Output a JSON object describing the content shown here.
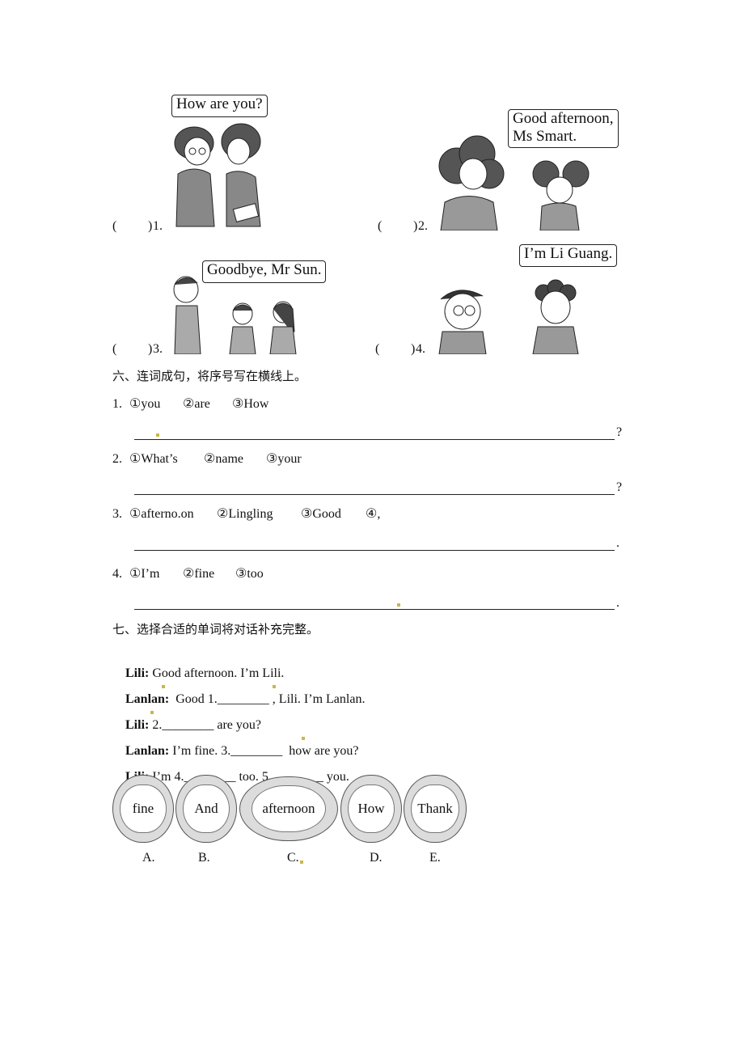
{
  "picture_matching": {
    "items": [
      {
        "number": "1.",
        "bracket_open": "(",
        "bracket_close": ")",
        "bubble": "How are you?"
      },
      {
        "number": "2.",
        "bracket_open": "(",
        "bracket_close": ")",
        "bubble": "Good afternoon,\nMs Smart."
      },
      {
        "number": "3.",
        "bracket_open": "(",
        "bracket_close": ")",
        "bubble": "Goodbye, Mr Sun."
      },
      {
        "number": "4.",
        "bracket_open": "(",
        "bracket_close": ")",
        "bubble": "I’m Li Guang."
      }
    ]
  },
  "section6": {
    "title": "六、连词成句，将序号写在横线上。",
    "questions": [
      {
        "label": "1.",
        "words": [
          "①you",
          "②are",
          "③How"
        ],
        "end_punct": "?"
      },
      {
        "label": "2.",
        "words": [
          "①What’s",
          "②name",
          "③your"
        ],
        "end_punct": "?"
      },
      {
        "label": "3.",
        "words": [
          "①afterno.on",
          "②Lingling",
          "③Good",
          "④,"
        ],
        "end_punct": "."
      },
      {
        "label": "4.",
        "words": [
          "①I’m",
          "②fine",
          "③too"
        ],
        "end_punct": "."
      }
    ]
  },
  "section7": {
    "title": "七、选择合适的单词将对话补充完整。",
    "dialogue": [
      {
        "speaker": "Lili:",
        "text": " Good afternoon. I’m Lili."
      },
      {
        "speaker": "Lanlan:",
        "text": "  Good 1.________ , Lili. I’m Lanlan."
      },
      {
        "speaker": "Lili:",
        "text": " 2.________ are you?"
      },
      {
        "speaker": "Lanlan:",
        "text": " I’m fine. 3.________  how are you?"
      },
      {
        "speaker": "Lili:",
        "text": " I’m 4.________ too. 5.________ you."
      }
    ],
    "options": [
      {
        "letter": "A.",
        "word": "fine"
      },
      {
        "letter": "B.",
        "word": "And"
      },
      {
        "letter": "C.",
        "word": "afternoon"
      },
      {
        "letter": "D.",
        "word": "How"
      },
      {
        "letter": "E.",
        "word": "Thank"
      }
    ]
  }
}
